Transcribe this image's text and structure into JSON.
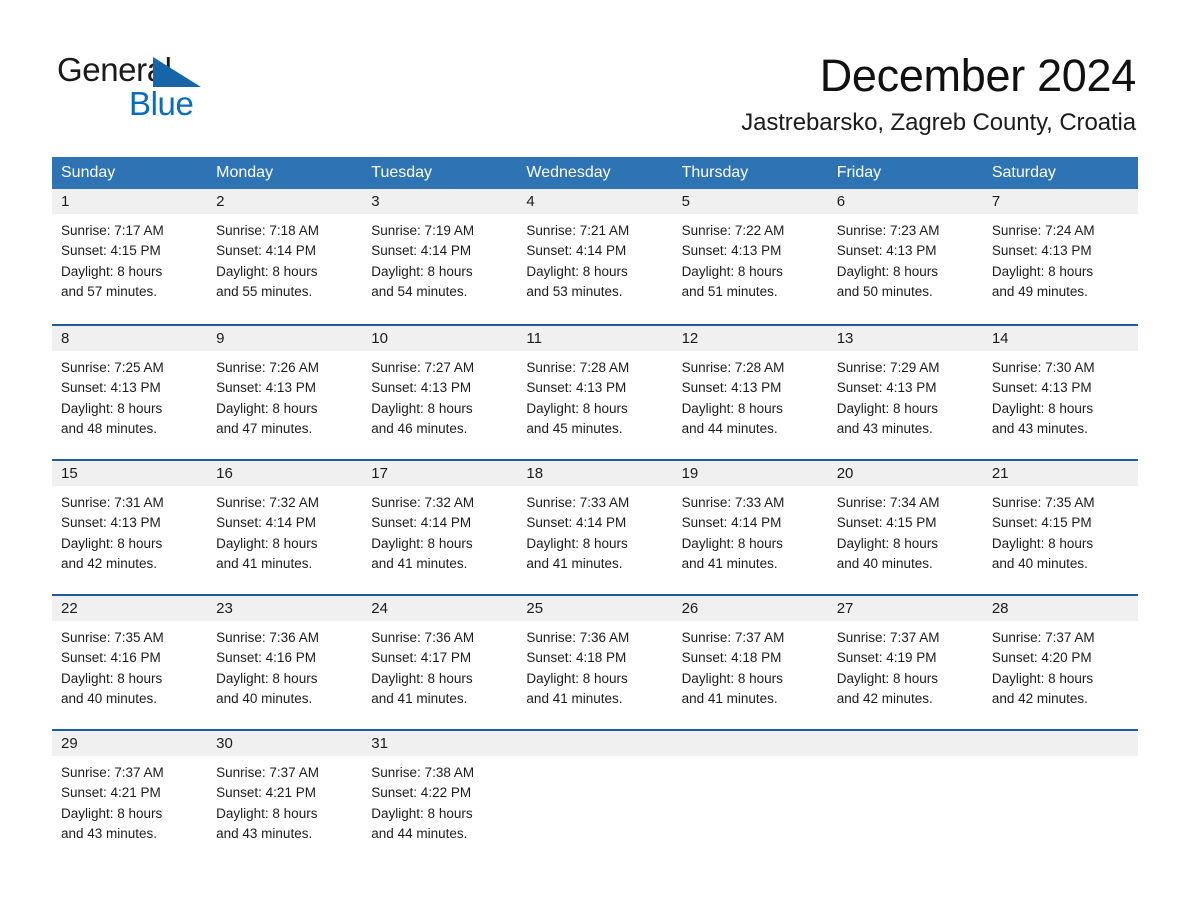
{
  "brand": {
    "name_part1": "General",
    "name_part2": "Blue",
    "flag_icon": "triangle-flag-icon",
    "colors": {
      "blue": "#0b6bb8",
      "dark": "#1a1a1a"
    }
  },
  "header": {
    "month_title": "December 2024",
    "location": "Jastrebarsko, Zagreb County, Croatia"
  },
  "theme": {
    "header_blue": "#2e74b5",
    "row_divider_blue": "#1f5c99",
    "day_band_gray": "#f0f0f0",
    "text_dark": "#1c1c1c"
  },
  "weekdays": [
    "Sunday",
    "Monday",
    "Tuesday",
    "Wednesday",
    "Thursday",
    "Friday",
    "Saturday"
  ],
  "weeks": [
    [
      {
        "day": "1",
        "sunrise": "Sunrise: 7:17 AM",
        "sunset": "Sunset: 4:15 PM",
        "daylight_1": "Daylight: 8 hours",
        "daylight_2": "and 57 minutes."
      },
      {
        "day": "2",
        "sunrise": "Sunrise: 7:18 AM",
        "sunset": "Sunset: 4:14 PM",
        "daylight_1": "Daylight: 8 hours",
        "daylight_2": "and 55 minutes."
      },
      {
        "day": "3",
        "sunrise": "Sunrise: 7:19 AM",
        "sunset": "Sunset: 4:14 PM",
        "daylight_1": "Daylight: 8 hours",
        "daylight_2": "and 54 minutes."
      },
      {
        "day": "4",
        "sunrise": "Sunrise: 7:21 AM",
        "sunset": "Sunset: 4:14 PM",
        "daylight_1": "Daylight: 8 hours",
        "daylight_2": "and 53 minutes."
      },
      {
        "day": "5",
        "sunrise": "Sunrise: 7:22 AM",
        "sunset": "Sunset: 4:13 PM",
        "daylight_1": "Daylight: 8 hours",
        "daylight_2": "and 51 minutes."
      },
      {
        "day": "6",
        "sunrise": "Sunrise: 7:23 AM",
        "sunset": "Sunset: 4:13 PM",
        "daylight_1": "Daylight: 8 hours",
        "daylight_2": "and 50 minutes."
      },
      {
        "day": "7",
        "sunrise": "Sunrise: 7:24 AM",
        "sunset": "Sunset: 4:13 PM",
        "daylight_1": "Daylight: 8 hours",
        "daylight_2": "and 49 minutes."
      }
    ],
    [
      {
        "day": "8",
        "sunrise": "Sunrise: 7:25 AM",
        "sunset": "Sunset: 4:13 PM",
        "daylight_1": "Daylight: 8 hours",
        "daylight_2": "and 48 minutes."
      },
      {
        "day": "9",
        "sunrise": "Sunrise: 7:26 AM",
        "sunset": "Sunset: 4:13 PM",
        "daylight_1": "Daylight: 8 hours",
        "daylight_2": "and 47 minutes."
      },
      {
        "day": "10",
        "sunrise": "Sunrise: 7:27 AM",
        "sunset": "Sunset: 4:13 PM",
        "daylight_1": "Daylight: 8 hours",
        "daylight_2": "and 46 minutes."
      },
      {
        "day": "11",
        "sunrise": "Sunrise: 7:28 AM",
        "sunset": "Sunset: 4:13 PM",
        "daylight_1": "Daylight: 8 hours",
        "daylight_2": "and 45 minutes."
      },
      {
        "day": "12",
        "sunrise": "Sunrise: 7:28 AM",
        "sunset": "Sunset: 4:13 PM",
        "daylight_1": "Daylight: 8 hours",
        "daylight_2": "and 44 minutes."
      },
      {
        "day": "13",
        "sunrise": "Sunrise: 7:29 AM",
        "sunset": "Sunset: 4:13 PM",
        "daylight_1": "Daylight: 8 hours",
        "daylight_2": "and 43 minutes."
      },
      {
        "day": "14",
        "sunrise": "Sunrise: 7:30 AM",
        "sunset": "Sunset: 4:13 PM",
        "daylight_1": "Daylight: 8 hours",
        "daylight_2": "and 43 minutes."
      }
    ],
    [
      {
        "day": "15",
        "sunrise": "Sunrise: 7:31 AM",
        "sunset": "Sunset: 4:13 PM",
        "daylight_1": "Daylight: 8 hours",
        "daylight_2": "and 42 minutes."
      },
      {
        "day": "16",
        "sunrise": "Sunrise: 7:32 AM",
        "sunset": "Sunset: 4:14 PM",
        "daylight_1": "Daylight: 8 hours",
        "daylight_2": "and 41 minutes."
      },
      {
        "day": "17",
        "sunrise": "Sunrise: 7:32 AM",
        "sunset": "Sunset: 4:14 PM",
        "daylight_1": "Daylight: 8 hours",
        "daylight_2": "and 41 minutes."
      },
      {
        "day": "18",
        "sunrise": "Sunrise: 7:33 AM",
        "sunset": "Sunset: 4:14 PM",
        "daylight_1": "Daylight: 8 hours",
        "daylight_2": "and 41 minutes."
      },
      {
        "day": "19",
        "sunrise": "Sunrise: 7:33 AM",
        "sunset": "Sunset: 4:14 PM",
        "daylight_1": "Daylight: 8 hours",
        "daylight_2": "and 41 minutes."
      },
      {
        "day": "20",
        "sunrise": "Sunrise: 7:34 AM",
        "sunset": "Sunset: 4:15 PM",
        "daylight_1": "Daylight: 8 hours",
        "daylight_2": "and 40 minutes."
      },
      {
        "day": "21",
        "sunrise": "Sunrise: 7:35 AM",
        "sunset": "Sunset: 4:15 PM",
        "daylight_1": "Daylight: 8 hours",
        "daylight_2": "and 40 minutes."
      }
    ],
    [
      {
        "day": "22",
        "sunrise": "Sunrise: 7:35 AM",
        "sunset": "Sunset: 4:16 PM",
        "daylight_1": "Daylight: 8 hours",
        "daylight_2": "and 40 minutes."
      },
      {
        "day": "23",
        "sunrise": "Sunrise: 7:36 AM",
        "sunset": "Sunset: 4:16 PM",
        "daylight_1": "Daylight: 8 hours",
        "daylight_2": "and 40 minutes."
      },
      {
        "day": "24",
        "sunrise": "Sunrise: 7:36 AM",
        "sunset": "Sunset: 4:17 PM",
        "daylight_1": "Daylight: 8 hours",
        "daylight_2": "and 41 minutes."
      },
      {
        "day": "25",
        "sunrise": "Sunrise: 7:36 AM",
        "sunset": "Sunset: 4:18 PM",
        "daylight_1": "Daylight: 8 hours",
        "daylight_2": "and 41 minutes."
      },
      {
        "day": "26",
        "sunrise": "Sunrise: 7:37 AM",
        "sunset": "Sunset: 4:18 PM",
        "daylight_1": "Daylight: 8 hours",
        "daylight_2": "and 41 minutes."
      },
      {
        "day": "27",
        "sunrise": "Sunrise: 7:37 AM",
        "sunset": "Sunset: 4:19 PM",
        "daylight_1": "Daylight: 8 hours",
        "daylight_2": "and 42 minutes."
      },
      {
        "day": "28",
        "sunrise": "Sunrise: 7:37 AM",
        "sunset": "Sunset: 4:20 PM",
        "daylight_1": "Daylight: 8 hours",
        "daylight_2": "and 42 minutes."
      }
    ],
    [
      {
        "day": "29",
        "sunrise": "Sunrise: 7:37 AM",
        "sunset": "Sunset: 4:21 PM",
        "daylight_1": "Daylight: 8 hours",
        "daylight_2": "and 43 minutes."
      },
      {
        "day": "30",
        "sunrise": "Sunrise: 7:37 AM",
        "sunset": "Sunset: 4:21 PM",
        "daylight_1": "Daylight: 8 hours",
        "daylight_2": "and 43 minutes."
      },
      {
        "day": "31",
        "sunrise": "Sunrise: 7:38 AM",
        "sunset": "Sunset: 4:22 PM",
        "daylight_1": "Daylight: 8 hours",
        "daylight_2": "and 44 minutes."
      },
      {
        "day": "",
        "sunrise": "",
        "sunset": "",
        "daylight_1": "",
        "daylight_2": ""
      },
      {
        "day": "",
        "sunrise": "",
        "sunset": "",
        "daylight_1": "",
        "daylight_2": ""
      },
      {
        "day": "",
        "sunrise": "",
        "sunset": "",
        "daylight_1": "",
        "daylight_2": ""
      },
      {
        "day": "",
        "sunrise": "",
        "sunset": "",
        "daylight_1": "",
        "daylight_2": ""
      }
    ]
  ]
}
